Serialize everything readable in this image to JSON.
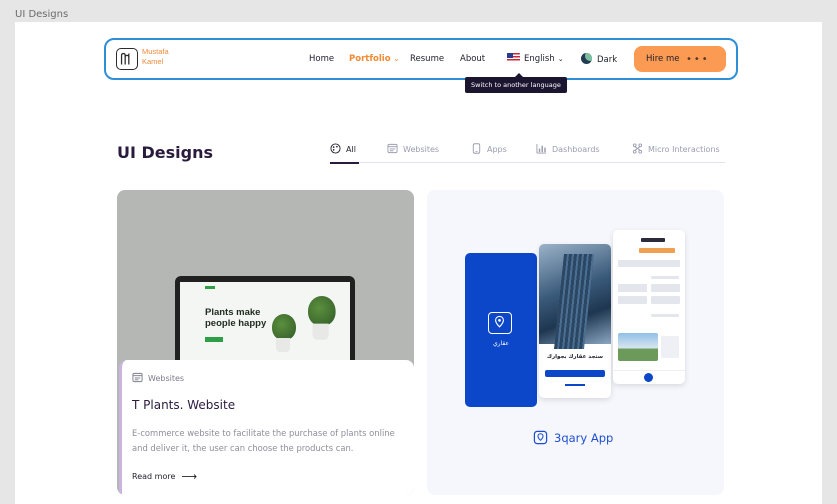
{
  "frame_label": "UI Designs",
  "nav": {
    "brand_line1": "Mustafa",
    "brand_line2": "Kamel",
    "links": [
      "Home",
      "Portfolio",
      "Resume",
      "About"
    ],
    "portfolio_chevron": "⌄",
    "language": "English",
    "language_tooltip": "Switch to another language",
    "theme": "Dark",
    "hire_label": "Hire me",
    "hire_dots": "•••",
    "accent_color": "#f28a33",
    "border_color": "#2d8fd8"
  },
  "section": {
    "title": "UI Designs",
    "filters": [
      {
        "label": "All",
        "icon": "palette-icon",
        "active": true
      },
      {
        "label": "Websites",
        "icon": "browser-icon",
        "active": false
      },
      {
        "label": "Apps",
        "icon": "phone-icon",
        "active": false
      },
      {
        "label": "Dashboards",
        "icon": "bar-chart-icon",
        "active": false
      },
      {
        "label": "Micro Interactions",
        "icon": "interactions-icon",
        "active": false
      }
    ]
  },
  "cards": [
    {
      "category": "Websites",
      "title": "T Plants. Website",
      "description": "E-commerce website to facilitate the purchase of plants online and deliver it, the user can choose the products can.",
      "read_more": "Read more",
      "preview_headline_1": "Plants make",
      "preview_headline_2": "people happy"
    },
    {
      "title": "3qary App",
      "app_splash_name": "عقاري",
      "app_onboarding_title": "ستجد عقارك بجوارك",
      "accent_color": "#0c47c9"
    }
  ]
}
